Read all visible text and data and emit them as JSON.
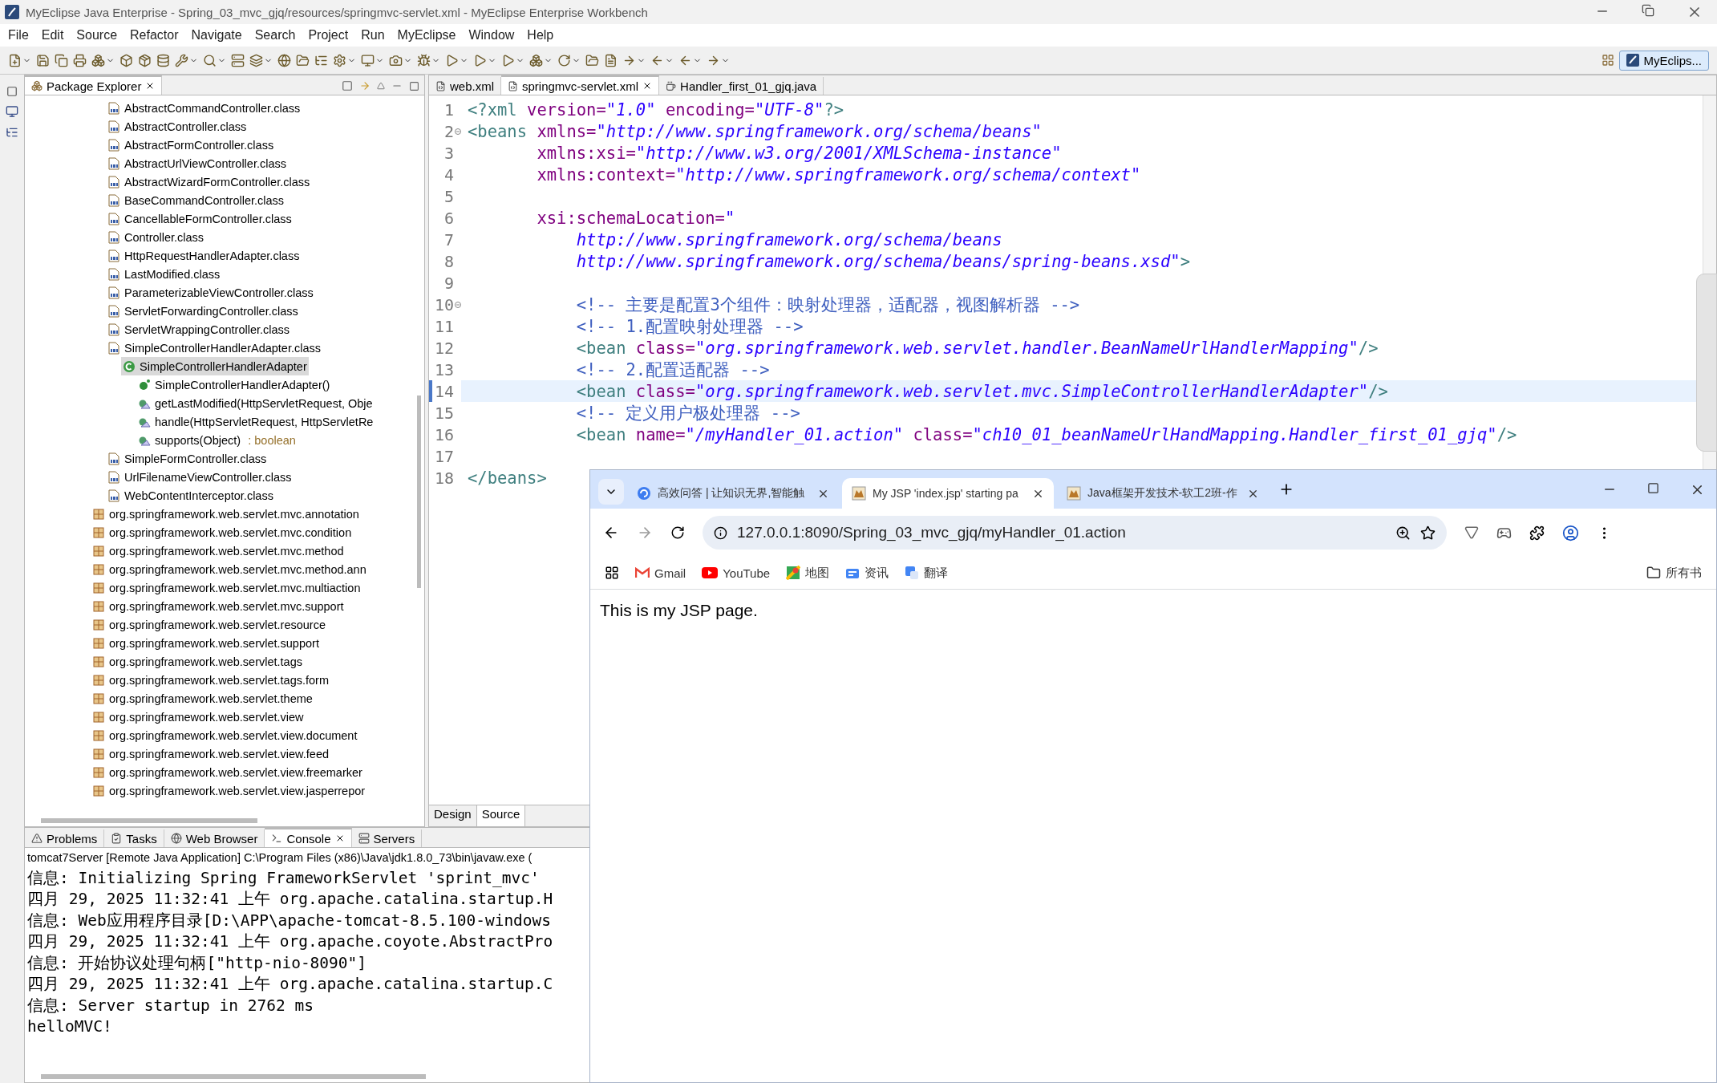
{
  "window": {
    "title": "MyEclipse Java Enterprise - Spring_03_mvc_gjq/resources/springmvc-servlet.xml - MyEclipse Enterprise Workbench"
  },
  "menu": [
    "File",
    "Edit",
    "Source",
    "Refactor",
    "Navigate",
    "Search",
    "Project",
    "Run",
    "MyEclipse",
    "Window",
    "Help"
  ],
  "perspective": {
    "label": "MyEclips...",
    "selected": true
  },
  "package_explorer": {
    "title": "Package Explorer",
    "tree": [
      {
        "kind": "class-file",
        "label": "AbstractCommandController.class",
        "selected": false
      },
      {
        "kind": "class-file",
        "label": "AbstractController.class",
        "selected": false
      },
      {
        "kind": "class-file",
        "label": "AbstractFormController.class",
        "selected": false
      },
      {
        "kind": "class-file",
        "label": "AbstractUrlViewController.class",
        "selected": false
      },
      {
        "kind": "class-file",
        "label": "AbstractWizardFormController.class",
        "selected": false
      },
      {
        "kind": "class-file",
        "label": "BaseCommandController.class",
        "selected": false
      },
      {
        "kind": "class-file",
        "label": "CancellableFormController.class",
        "selected": false
      },
      {
        "kind": "class-file",
        "label": "Controller.class",
        "selected": false
      },
      {
        "kind": "class-file",
        "label": "HttpRequestHandlerAdapter.class",
        "selected": false
      },
      {
        "kind": "class-file",
        "label": "LastModified.class",
        "selected": false
      },
      {
        "kind": "class-file",
        "label": "ParameterizableViewController.class",
        "selected": false
      },
      {
        "kind": "class-file",
        "label": "ServletForwardingController.class",
        "selected": false
      },
      {
        "kind": "class-file",
        "label": "ServletWrappingController.class",
        "selected": false
      },
      {
        "kind": "class-file",
        "label": "SimpleControllerHandlerAdapter.class",
        "selected": false,
        "children": [
          {
            "kind": "class",
            "label": "SimpleControllerHandlerAdapter",
            "selected": true,
            "children": [
              {
                "kind": "constructor",
                "label": "SimpleControllerHandlerAdapter()",
                "selected": false
              },
              {
                "kind": "method",
                "label": "getLastModified(HttpServletRequest, Obje",
                "selected": false
              },
              {
                "kind": "method",
                "label": "handle(HttpServletRequest, HttpServletRe",
                "selected": false
              },
              {
                "kind": "method",
                "label": "supports(Object)",
                "suffix": ": boolean",
                "selected": false
              }
            ]
          }
        ]
      },
      {
        "kind": "class-file",
        "label": "SimpleFormController.class",
        "selected": false
      },
      {
        "kind": "class-file",
        "label": "UrlFilenameViewController.class",
        "selected": false
      },
      {
        "kind": "class-file",
        "label": "WebContentInterceptor.class",
        "selected": false
      },
      {
        "kind": "package",
        "label": "org.springframework.web.servlet.mvc.annotation",
        "selected": false
      },
      {
        "kind": "package",
        "label": "org.springframework.web.servlet.mvc.condition",
        "selected": false
      },
      {
        "kind": "package",
        "label": "org.springframework.web.servlet.mvc.method",
        "selected": false
      },
      {
        "kind": "package",
        "label": "org.springframework.web.servlet.mvc.method.ann",
        "selected": false
      },
      {
        "kind": "package",
        "label": "org.springframework.web.servlet.mvc.multiaction",
        "selected": false
      },
      {
        "kind": "package",
        "label": "org.springframework.web.servlet.mvc.support",
        "selected": false
      },
      {
        "kind": "package",
        "label": "org.springframework.web.servlet.resource",
        "selected": false
      },
      {
        "kind": "package",
        "label": "org.springframework.web.servlet.support",
        "selected": false
      },
      {
        "kind": "package",
        "label": "org.springframework.web.servlet.tags",
        "selected": false
      },
      {
        "kind": "package",
        "label": "org.springframework.web.servlet.tags.form",
        "selected": false
      },
      {
        "kind": "package",
        "label": "org.springframework.web.servlet.theme",
        "selected": false
      },
      {
        "kind": "package",
        "label": "org.springframework.web.servlet.view",
        "selected": false
      },
      {
        "kind": "package",
        "label": "org.springframework.web.servlet.view.document",
        "selected": false
      },
      {
        "kind": "package",
        "label": "org.springframework.web.servlet.view.feed",
        "selected": false
      },
      {
        "kind": "package",
        "label": "org.springframework.web.servlet.view.freemarker",
        "selected": false
      },
      {
        "kind": "package",
        "label": "org.springframework.web.servlet.view.jasperrepor",
        "selected": false
      }
    ]
  },
  "editor": {
    "tabs": [
      {
        "kind": "xml",
        "label": "web.xml",
        "selected": false
      },
      {
        "kind": "xml",
        "label": "springmvc-servlet.xml",
        "selected": true
      },
      {
        "kind": "java",
        "label": "Handler_first_01_gjq.java",
        "selected": false
      }
    ],
    "lines": [
      {
        "number": "1",
        "current": false,
        "foldable": false,
        "segments": [
          {
            "kind": "tag",
            "text": "<?xml"
          },
          {
            "kind": "attr",
            "text": " version="
          },
          {
            "kind": "value",
            "text": "\"1.0\""
          },
          {
            "kind": "attr",
            "text": " encoding="
          },
          {
            "kind": "value",
            "text": "\"UTF-8\""
          },
          {
            "kind": "tag",
            "text": "?>"
          }
        ]
      },
      {
        "number": "2",
        "current": false,
        "foldable": true,
        "segments": [
          {
            "kind": "tag",
            "text": "<beans"
          },
          {
            "kind": "attr",
            "text": " xmlns="
          },
          {
            "kind": "value",
            "text": "\"http://www.springframework.org/schema/beans\""
          }
        ]
      },
      {
        "number": "3",
        "current": false,
        "foldable": false,
        "segments": [
          {
            "kind": "attr",
            "text": "       xmlns:xsi="
          },
          {
            "kind": "value",
            "text": "\"http://www.w3.org/2001/XMLSchema-instance\""
          }
        ]
      },
      {
        "number": "4",
        "current": false,
        "foldable": false,
        "segments": [
          {
            "kind": "attr",
            "text": "       xmlns:context="
          },
          {
            "kind": "value",
            "text": "\"http://www.springframework.org/schema/context\""
          }
        ]
      },
      {
        "number": "5",
        "current": false,
        "foldable": false
      },
      {
        "number": "6",
        "current": false,
        "foldable": false,
        "segments": [
          {
            "kind": "attr",
            "text": "       xsi:schemaLocation="
          },
          {
            "kind": "value",
            "text": "\""
          }
        ]
      },
      {
        "number": "7",
        "current": false,
        "foldable": false,
        "segments": [
          {
            "kind": "value",
            "text": "           http://www.springframework.org/schema/beans"
          }
        ]
      },
      {
        "number": "8",
        "current": false,
        "foldable": false,
        "segments": [
          {
            "kind": "value",
            "text": "           http://www.springframework.org/schema/beans/spring-beans.xsd\""
          },
          {
            "kind": "tag",
            "text": ">"
          }
        ]
      },
      {
        "number": "9",
        "current": false,
        "foldable": false
      },
      {
        "number": "10",
        "current": false,
        "foldable": true,
        "segments": [
          {
            "kind": "comment",
            "text": "           <!-- 主要是配置3个组件：映射处理器，适配器，视图解析器 -->"
          }
        ]
      },
      {
        "number": "11",
        "current": false,
        "foldable": false,
        "segments": [
          {
            "kind": "comment",
            "text": "           <!-- 1.配置映射处理器 -->"
          }
        ]
      },
      {
        "number": "12",
        "current": false,
        "foldable": false,
        "segments": [
          {
            "kind": "tag",
            "text": "           <bean"
          },
          {
            "kind": "attr",
            "text": " class="
          },
          {
            "kind": "value",
            "text": "\"org.springframework.web.servlet.handler.BeanNameUrlHandlerMapping\""
          },
          {
            "kind": "tag",
            "text": "/>"
          }
        ]
      },
      {
        "number": "13",
        "current": false,
        "foldable": false,
        "segments": [
          {
            "kind": "comment",
            "text": "           <!-- 2.配置适配器 -->"
          }
        ]
      },
      {
        "number": "14",
        "current": true,
        "foldable": false,
        "segments": [
          {
            "kind": "tag",
            "text": "           <bean"
          },
          {
            "kind": "attr",
            "text": " class="
          },
          {
            "kind": "value",
            "text": "\"org.springframework.web.servlet.mvc.SimpleControllerHandlerAdapter\""
          },
          {
            "kind": "tag",
            "text": "/>"
          }
        ]
      },
      {
        "number": "15",
        "current": false,
        "foldable": false,
        "segments": [
          {
            "kind": "comment",
            "text": "           <!-- 定义用户极处理器 -->"
          }
        ]
      },
      {
        "number": "16",
        "current": false,
        "foldable": false,
        "segments": [
          {
            "kind": "tag",
            "text": "           <bean"
          },
          {
            "kind": "attr",
            "text": " name="
          },
          {
            "kind": "value",
            "text": "\"/myHandler_01.action\""
          },
          {
            "kind": "attr",
            "text": " class="
          },
          {
            "kind": "value",
            "text": "\"ch10_01_beanNameUrlHandMapping.Handler_first_01_gjq\""
          },
          {
            "kind": "tag",
            "text": "/>"
          }
        ]
      },
      {
        "number": "17",
        "current": false,
        "foldable": false
      },
      {
        "number": "18",
        "current": false,
        "foldable": false,
        "segments": [
          {
            "kind": "tag",
            "text": "</beans>"
          }
        ]
      }
    ],
    "mode_tabs": [
      {
        "label": "Design",
        "selected": false
      },
      {
        "label": "Source",
        "selected": true
      }
    ]
  },
  "console": {
    "tabs": [
      {
        "kind": "problems",
        "label": "Problems",
        "selected": false
      },
      {
        "kind": "tasks",
        "label": "Tasks",
        "selected": false
      },
      {
        "kind": "browser",
        "label": "Web Browser",
        "selected": false
      },
      {
        "kind": "console",
        "label": "Console",
        "selected": true
      },
      {
        "kind": "servers",
        "label": "Servers",
        "selected": false
      }
    ],
    "process": "tomcat7Server [Remote Java Application] C:\\Program Files (x86)\\Java\\jdk1.8.0_73\\bin\\javaw.exe (",
    "lines": [
      "信息: Initializing Spring FrameworkServlet 'sprint_mvc'",
      "四月 29, 2025 11:32:41 上午 org.apache.catalina.startup.H",
      "信息: Web应用程序目录[D:\\APP\\apache-tomcat-8.5.100-windows",
      "四月 29, 2025 11:32:41 上午 org.apache.coyote.AbstractPro",
      "信息: 开始协议处理句柄[\"http-nio-8090\"]",
      "四月 29, 2025 11:32:41 上午 org.apache.catalina.startup.C",
      "信息: Server startup in 2762 ms",
      "helloMVC!"
    ]
  },
  "browser": {
    "tabs": [
      {
        "kind": "qa",
        "title": "高效问答 | 让知识无界,智能触",
        "selected": false
      },
      {
        "kind": "tomcat",
        "title": "My JSP 'index.jsp' starting pa",
        "selected": true
      },
      {
        "kind": "tomcat",
        "title": "Java框架开发技术-软工2班-作",
        "selected": false
      }
    ],
    "url": "127.0.0.1:8090/Spring_03_mvc_gjq/myHandler_01.action",
    "bookmarks": [
      {
        "kind": "gmail",
        "label": "Gmail"
      },
      {
        "kind": "youtube",
        "label": "YouTube"
      },
      {
        "kind": "maps",
        "label": "地图"
      },
      {
        "kind": "news",
        "label": "资讯"
      },
      {
        "kind": "translate",
        "label": "翻译"
      }
    ],
    "all_bookmarks": "所有书",
    "page_text": "This is my JSP page."
  }
}
